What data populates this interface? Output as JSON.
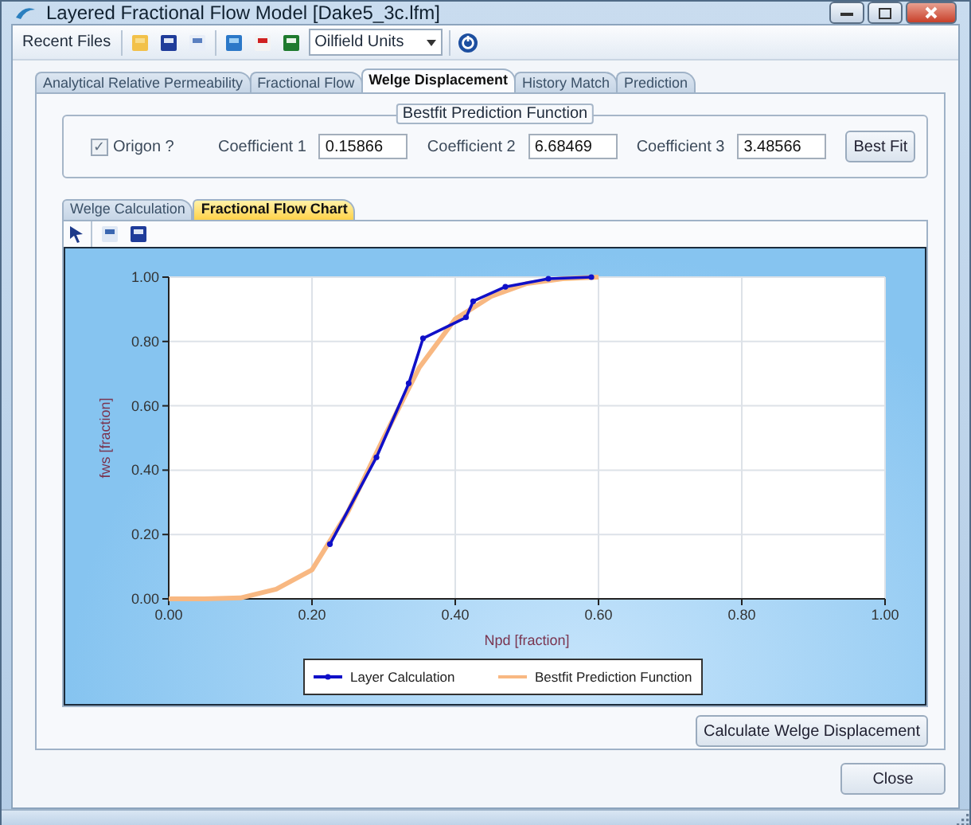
{
  "window": {
    "title": "Layered Fractional Flow Model [Dake5_3c.lfm]"
  },
  "toolbar": {
    "recent_files": "Recent Files",
    "units": "Oilfield Units"
  },
  "tabs": [
    {
      "label": "Analytical Relative Permeability",
      "selected": false
    },
    {
      "label": "Fractional Flow",
      "selected": false
    },
    {
      "label": "Welge Displacement",
      "selected": true
    },
    {
      "label": "History Match",
      "selected": false
    },
    {
      "label": "Prediction",
      "selected": false
    }
  ],
  "bestfit": {
    "title": "Bestfit Prediction Function",
    "origin": {
      "label": "Origon ?",
      "checked": true,
      "mark": "✓"
    },
    "coefficients": [
      {
        "label": "Coefficient 1",
        "value": "0.15866"
      },
      {
        "label": "Coefficient 2",
        "value": "6.68469"
      },
      {
        "label": "Coefficient 3",
        "value": "3.48566"
      }
    ],
    "button": "Best Fit"
  },
  "subtabs": [
    {
      "label": "Welge Calculation",
      "selected": false
    },
    {
      "label": "Fractional Flow Chart",
      "selected": true
    }
  ],
  "chart": {
    "chart_data": {
      "type": "line",
      "grid": true,
      "legend": "bottom",
      "xlabel": "Npd [fraction]",
      "ylabel": "fws [fraction]",
      "xlim": [
        0,
        1
      ],
      "ylim": [
        0,
        1
      ],
      "xticks": [
        {
          "value": 0,
          "label": "0.00"
        },
        {
          "value": 0.2,
          "label": "0.20"
        },
        {
          "value": 0.4,
          "label": "0.40"
        },
        {
          "value": 0.6,
          "label": "0.60"
        },
        {
          "value": 0.8,
          "label": "0.80"
        },
        {
          "value": 1,
          "label": "1.00"
        }
      ],
      "yticks": [
        {
          "value": 0,
          "label": "0.00"
        },
        {
          "value": 0.2,
          "label": "0.20"
        },
        {
          "value": 0.4,
          "label": "0.40"
        },
        {
          "value": 0.6,
          "label": "0.60"
        },
        {
          "value": 0.8,
          "label": "0.80"
        },
        {
          "value": 1,
          "label": "1.00"
        }
      ],
      "series": [
        {
          "name": "Layer Calculation",
          "color": "#1010c8",
          "marker": "circle",
          "x": [
            0.225,
            0.29,
            0.335,
            0.355,
            0.415,
            0.425,
            0.47,
            0.53,
            0.59
          ],
          "values": [
            0.17,
            0.44,
            0.67,
            0.81,
            0.875,
            0.925,
            0.97,
            0.995,
            1.0
          ]
        },
        {
          "name": "Bestfit Prediction Function",
          "color": "#f8b882",
          "x": [
            0,
            0.05,
            0.1,
            0.15,
            0.2,
            0.25,
            0.3,
            0.35,
            0.4,
            0.45,
            0.5,
            0.55,
            0.6
          ],
          "values": [
            0,
            0,
            0.003,
            0.03,
            0.09,
            0.27,
            0.5,
            0.72,
            0.87,
            0.94,
            0.98,
            0.995,
            1.0
          ]
        }
      ]
    }
  },
  "calculate_button": "Calculate Welge Displacement",
  "close_button": "Close"
}
